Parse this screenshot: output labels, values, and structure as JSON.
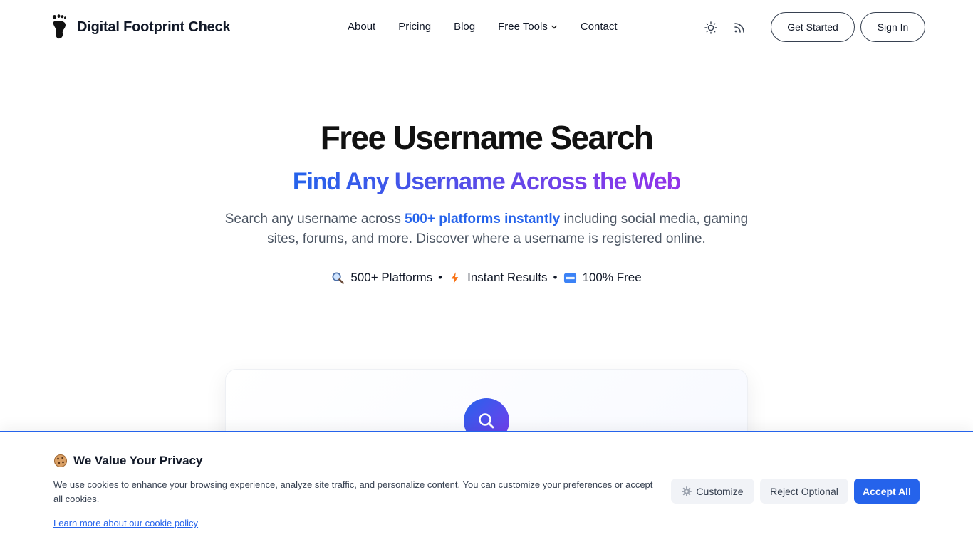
{
  "header": {
    "brand": "Digital Footprint Check",
    "nav": [
      {
        "label": "About"
      },
      {
        "label": "Pricing"
      },
      {
        "label": "Blog"
      },
      {
        "label": "Free Tools",
        "has_dropdown": true
      },
      {
        "label": "Contact"
      }
    ],
    "icons": [
      "sun-icon",
      "rss-icon"
    ],
    "get_started_label": "Get Started",
    "sign_in_label": "Sign In"
  },
  "hero": {
    "title": "Free Username Search",
    "subtitle": "Find Any Username Across the Web",
    "desc_before": "Search any username across ",
    "desc_highlight": "500+ platforms instantly",
    "desc_after": " including social media, gaming sites, forums, and more. Discover where a username is registered online.",
    "features": [
      {
        "icon": "magnifier-icon",
        "label": "500+ Platforms"
      },
      {
        "icon": "lightning-icon",
        "label": "Instant Results"
      },
      {
        "icon": "free-badge-icon",
        "label": "100% Free"
      }
    ],
    "separator": "•"
  },
  "search_card": {
    "icon": "search-icon"
  },
  "cookie_banner": {
    "title": "We Value Your Privacy",
    "text": "We use cookies to enhance your browsing experience, analyze site traffic, and personalize content. You can customize your preferences or accept all cookies.",
    "link": "Learn more about our cookie policy",
    "customize_label": "Customize",
    "reject_label": "Reject Optional",
    "accept_label": "Accept All"
  },
  "colors": {
    "accent": "#2563eb",
    "gradient_start": "#2563eb",
    "gradient_end": "#9333ea",
    "text": "#111827",
    "muted": "#4b5563"
  }
}
